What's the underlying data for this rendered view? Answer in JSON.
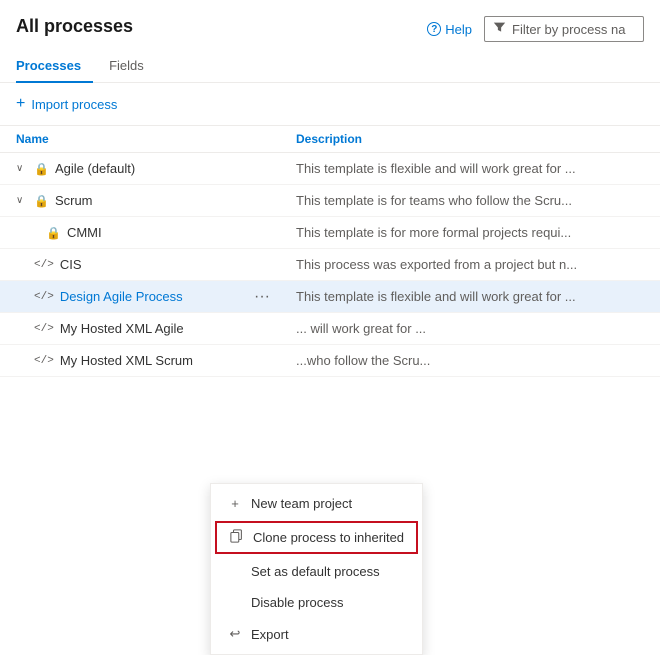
{
  "header": {
    "title": "All processes",
    "help_label": "Help",
    "filter_placeholder": "Filter by process na"
  },
  "tabs": [
    {
      "label": "Processes",
      "active": true
    },
    {
      "label": "Fields",
      "active": false
    }
  ],
  "toolbar": {
    "import_label": "Import process"
  },
  "table": {
    "columns": [
      {
        "label": "Name"
      },
      {
        "label": "Description"
      }
    ],
    "rows": [
      {
        "expand": "∨",
        "icon": "lock",
        "name": "Agile (default)",
        "name_link": false,
        "indent": 0,
        "description": "This template is flexible and will work great for ...",
        "show_ellipsis": false,
        "highlighted": false
      },
      {
        "expand": "∨",
        "icon": "lock",
        "name": "Scrum",
        "name_link": false,
        "indent": 0,
        "description": "This template is for teams who follow the Scru...",
        "show_ellipsis": false,
        "highlighted": false
      },
      {
        "expand": "",
        "icon": "lock",
        "name": "CMMI",
        "name_link": false,
        "indent": 1,
        "description": "This template is for more formal projects requi...",
        "show_ellipsis": false,
        "highlighted": false
      },
      {
        "expand": "",
        "icon": "code",
        "name": "CIS",
        "name_link": false,
        "indent": 0,
        "description": "This process was exported from a project but n...",
        "show_ellipsis": false,
        "highlighted": false
      },
      {
        "expand": "",
        "icon": "code",
        "name": "Design Agile Process",
        "name_link": true,
        "indent": 0,
        "description": "This template is flexible and will work great for ...",
        "show_ellipsis": true,
        "highlighted": true
      },
      {
        "expand": "",
        "icon": "code",
        "name": "My Hosted XML Agile",
        "name_link": false,
        "indent": 0,
        "description": "... will work great for ...",
        "show_ellipsis": false,
        "highlighted": false
      },
      {
        "expand": "",
        "icon": "code",
        "name": "My Hosted XML Scrum",
        "name_link": false,
        "indent": 0,
        "description": "...who follow the Scru...",
        "show_ellipsis": false,
        "highlighted": false
      }
    ]
  },
  "context_menu": {
    "items": [
      {
        "icon": "+",
        "label": "New team project",
        "highlighted": false
      },
      {
        "icon": "clone",
        "label": "Clone process to inherited",
        "highlighted": true
      },
      {
        "icon": "",
        "label": "Set as default process",
        "highlighted": false
      },
      {
        "icon": "",
        "label": "Disable process",
        "highlighted": false
      },
      {
        "icon": "export",
        "label": "Export",
        "highlighted": false
      }
    ]
  },
  "icons": {
    "help": "?",
    "filter": "⧉",
    "lock": "🔒",
    "code": "</>",
    "plus": "+",
    "ellipsis": "···",
    "new_project": "+",
    "clone": "⧉",
    "export": "↩"
  }
}
